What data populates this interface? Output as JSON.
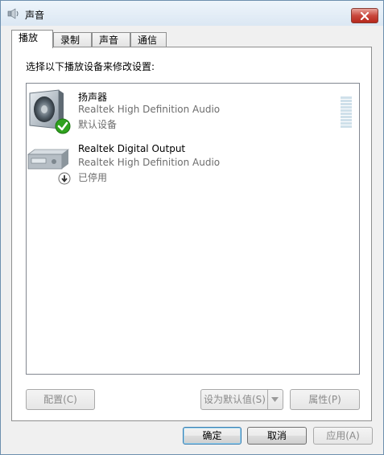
{
  "window": {
    "title": "声音",
    "close_label": "关闭"
  },
  "tabs": [
    {
      "label": "播放",
      "active": true
    },
    {
      "label": "录制",
      "active": false
    },
    {
      "label": "声音",
      "active": false
    },
    {
      "label": "通信",
      "active": false
    }
  ],
  "instruction": "选择以下播放设备来修改设置:",
  "devices": [
    {
      "name": "扬声器",
      "driver": "Realtek High Definition Audio",
      "status": "默认设备",
      "icon": "speaker-icon",
      "badge": "check-icon",
      "level": 0.0
    },
    {
      "name": "Realtek Digital Output",
      "driver": "Realtek High Definition Audio",
      "status": "已停用",
      "icon": "digital-output-icon",
      "badge": "disabled-down-arrow-icon"
    }
  ],
  "buttons": {
    "configure": "配置(C)",
    "set_default": "设为默认值(S)",
    "properties": "属性(P)",
    "ok": "确定",
    "cancel": "取消",
    "apply": "应用(A)"
  },
  "colors": {
    "accent": "#3c7fb1",
    "check_green": "#2fa21e",
    "close_red": "#c9473d"
  }
}
